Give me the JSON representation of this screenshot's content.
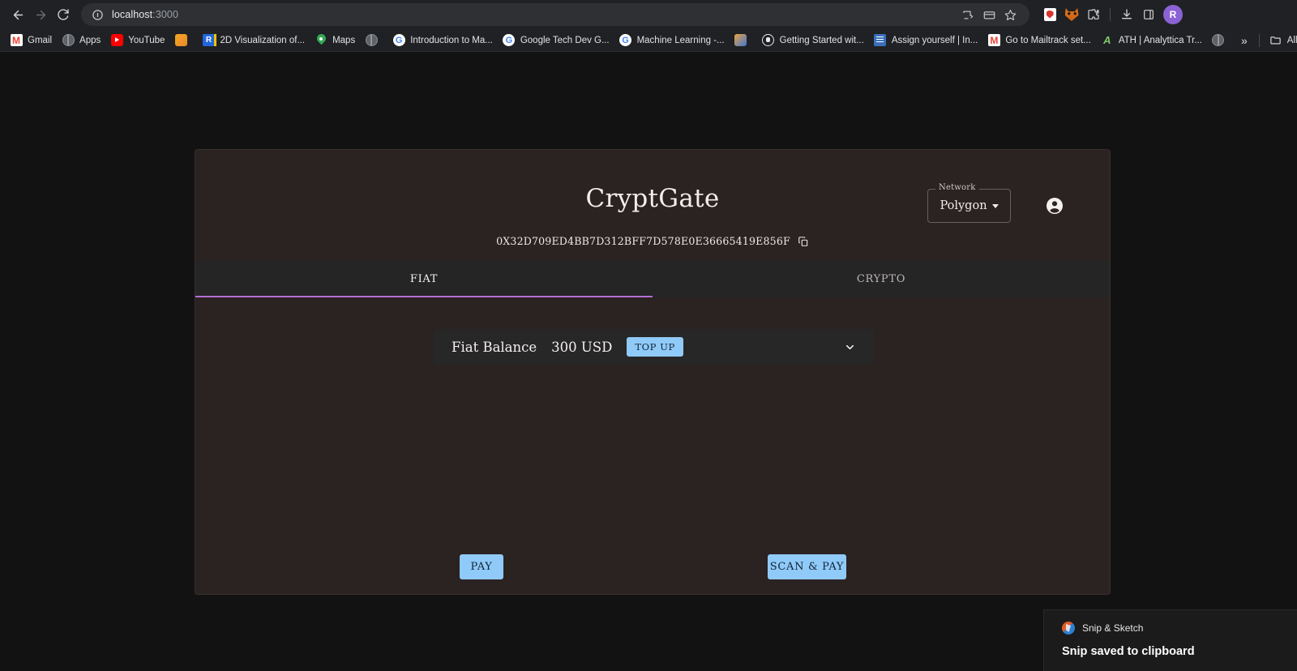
{
  "browser": {
    "back_label": "Back",
    "forward_label": "Forward",
    "reload_label": "Reload",
    "url_host": "localhost",
    "url_port": ":3000",
    "omnibox_icons": [
      "info-circle-icon"
    ],
    "address_actions": [
      "cast-icon",
      "payment-card-icon",
      "bookmark-star-icon"
    ],
    "toolbar_icons": [
      "extension-shield-icon",
      "metamask-fox-icon",
      "extensions-puzzle-icon",
      "downloads-icon",
      "side-panel-icon"
    ],
    "profile_initial": "R",
    "bookmarks": [
      {
        "label": "Gmail",
        "icon": "gmail-icon"
      },
      {
        "label": "Apps",
        "icon": "apps-globe-icon"
      },
      {
        "label": "YouTube",
        "icon": "youtube-icon"
      },
      {
        "label": "",
        "icon": "orange-bookmark-icon"
      },
      {
        "label": "2D Visualization of...",
        "icon": "research-r-icon"
      },
      {
        "label": "Maps",
        "icon": "google-maps-pin-icon"
      },
      {
        "label": "",
        "icon": "globe-icon"
      },
      {
        "label": "Introduction to Ma...",
        "icon": "google-g-icon"
      },
      {
        "label": "Google Tech Dev G...",
        "icon": "google-g-icon"
      },
      {
        "label": "Machine Learning -...",
        "icon": "google-g-icon"
      },
      {
        "label": "",
        "icon": "puzzle-colored-icon"
      },
      {
        "label": "Getting Started wit...",
        "icon": "github-icon"
      },
      {
        "label": "Assign yourself | In...",
        "icon": "spreadsheet-icon"
      },
      {
        "label": "Go to Mailtrack set...",
        "icon": "gmail-icon"
      },
      {
        "label": "ATH | Analyttica Tr...",
        "icon": "analyttica-a-icon"
      },
      {
        "label": "",
        "icon": "globe-icon"
      }
    ],
    "overflow_label": "»",
    "all_bookmarks_label": "All Boo",
    "all_bookmarks_icon": "folder-icon"
  },
  "app": {
    "title": "CryptGate",
    "wallet_address": "0X32D709ED4BB7D312BFF7D578E0E36665419E856F",
    "copy_icon": "copy-icon",
    "account_icon": "account-circle-icon",
    "network": {
      "legend": "Network",
      "value": "Polygon",
      "caret_icon": "chevron-down-icon"
    },
    "tabs": [
      {
        "label": "FIAT",
        "active": true
      },
      {
        "label": "CRYPTO",
        "active": false
      }
    ],
    "balance": {
      "label": "Fiat Balance",
      "amount": "300 USD",
      "topup_label": "TOP UP",
      "expand_icon": "chevron-down-icon"
    },
    "actions": {
      "pay_label": "PAY",
      "scan_pay_label": "SCAN & PAY"
    },
    "colors": {
      "card_bg": "#2b2222",
      "tab_bg": "#252525",
      "accent_underline": "#b36fd0",
      "button_bg": "#90caf9",
      "button_text": "#0d2436"
    }
  },
  "toast": {
    "app_name": "Snip & Sketch",
    "message": "Snip saved to clipboard",
    "icon": "snip-sketch-icon"
  }
}
